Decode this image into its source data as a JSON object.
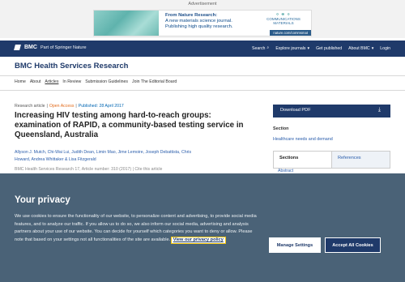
{
  "advertisement": {
    "label": "Advertisement",
    "line1": "From Nature Research:",
    "line2": "A new materials science journal.",
    "line3": "Publishing high quality research.",
    "logo_line1": "COMMUNICATIONS",
    "logo_line2": "MATERIALS",
    "url": "nature.com/commsmat"
  },
  "navbar": {
    "brand": "BMC",
    "brand_suffix": "Part of Springer Nature",
    "links": [
      "Search",
      "Explore journals",
      "Get published",
      "About BMC",
      "Login"
    ]
  },
  "journal": {
    "title": "BMC Health Services Research"
  },
  "subnav": {
    "items": [
      "Home",
      "About",
      "Articles",
      "In Review",
      "Submission Guidelines",
      "Join The Editorial Board"
    ]
  },
  "article": {
    "type": "Research article",
    "access": "Open Access",
    "published": "Published: 28 April 2017",
    "title": "Increasing HIV testing among hard-to-reach groups: examination of RAPID, a community-based testing service in Queensland, Australia",
    "authors_line1": "Allyson J. Mutch, Chi-Wai Lui, Judith Dean, Limin Mao, Jime Lemoire, Joseph Debattista, Chris",
    "authors_line2": "Howard, Andrea Whittaker & Lisa Fitzgerald",
    "citation": "BMC Health Services Research 17, Article number: 310 (2017) | Cite this article"
  },
  "sidebar": {
    "download_label": "Download PDF",
    "section_heading": "Section",
    "section_value": "Healthcare needs and demand",
    "tabs": [
      "Sections",
      "References"
    ],
    "abstract_link": "Abstract"
  },
  "privacy": {
    "title": "Your privacy",
    "text": "We use cookies to ensure the functionality of our website, to personalize content and advertising, to provide social media features, and to analyze our traffic. If you allow us to do so, we also inform our social media, advertising and analysis partners about your use of our website. You can decide for yourself which categories you want to deny or allow. Please note that based on your settings not all functionalities of the site are available.",
    "link": "View our privacy policy",
    "manage_label": "Manage Settings",
    "accept_label": "Accept All Cookies"
  },
  "colors": {
    "brand_navy": "#1f3a6a",
    "overlay": "#4a6277",
    "open_access": "#e26a1a",
    "link_blue": "#2a5dab"
  }
}
